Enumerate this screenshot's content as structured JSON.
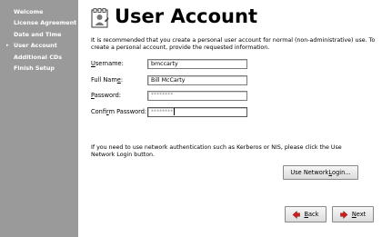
{
  "sidebar": {
    "items": [
      {
        "label": "Welcome",
        "current": false
      },
      {
        "label": "License Agreement",
        "current": false
      },
      {
        "label": "Date and Time",
        "current": false
      },
      {
        "label": "User Account",
        "current": true
      },
      {
        "label": "Additional CDs",
        "current": false
      },
      {
        "label": "Finish Setup",
        "current": false
      }
    ],
    "current_marker": "▸"
  },
  "header": {
    "title": "User Account",
    "icon": "user-account-icon"
  },
  "intro_text": "It is recommended that you create a personal user account for normal (non-administrative) use.  To create a personal account, provide the requested information.",
  "form": {
    "username": {
      "label_mnemonic": "U",
      "label_rest": "sername:",
      "value": "bmccarty"
    },
    "full_name": {
      "label_pre": "Full Nam",
      "label_mnemonic": "e",
      "label_post": ":",
      "value": "Bill McCarty"
    },
    "password": {
      "label_mnemonic": "P",
      "label_rest": "assword:",
      "value": "********"
    },
    "confirm_password": {
      "label_pre": "Confi",
      "label_mnemonic": "r",
      "label_post": "m Password:",
      "value": "********"
    }
  },
  "network_text": "If you need to use network authentication such as Kerberos or NIS, please click the Use Network Login button.",
  "buttons": {
    "network_login": {
      "label_pre": "Use Network ",
      "label_mnemonic": "L",
      "label_post": "ogin..."
    },
    "back": {
      "label_pre": "",
      "label_mnemonic": "B",
      "label_post": "ack"
    },
    "next": {
      "label_pre": "",
      "label_mnemonic": "N",
      "label_post": "ext"
    }
  },
  "colors": {
    "sidebar_bg": "#9a9a9a",
    "sidebar_text": "#ffffff",
    "background": "#ffffff",
    "arrow_red": "#c8201c"
  }
}
